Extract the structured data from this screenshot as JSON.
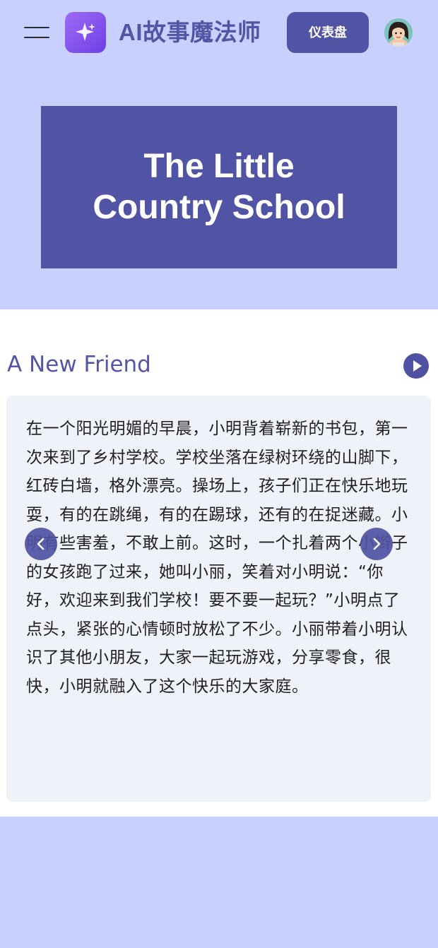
{
  "header": {
    "app_title": "AI故事魔法师",
    "dashboard_label": "仪表盘",
    "menu_icon": "hamburger-menu-icon",
    "logo_icon": "sparkle-icon",
    "avatar_icon": "user-avatar"
  },
  "cover": {
    "title": "The Little Country School"
  },
  "chapter": {
    "title": "A New Friend",
    "play_icon": "play-icon",
    "text": "在一个阳光明媚的早晨，小明背着崭新的书包，第一次来到了乡村学校。学校坐落在绿树环绕的山脚下，红砖白墙，格外漂亮。操场上，孩子们正在快乐地玩耍，有的在跳绳，有的在踢球，还有的在捉迷藏。小明有些害羞，不敢上前。这时，一个扎着两个小辫子的女孩跑了过来，她叫小丽，笑着对小明说：“你好，欢迎来到我们学校！要不要一起玩？”小明点了点头，紧张的心情顿时放松了不少。小丽带着小明认识了其他小朋友，大家一起玩游戏，分享零食，很快，小明就融入了这个快乐的大家庭。"
  },
  "nav": {
    "prev_icon": "chevron-left-icon",
    "next_icon": "chevron-right-icon"
  },
  "colors": {
    "background": "#c8d0fd",
    "accent": "#5154a4",
    "card": "#eff2f8"
  }
}
